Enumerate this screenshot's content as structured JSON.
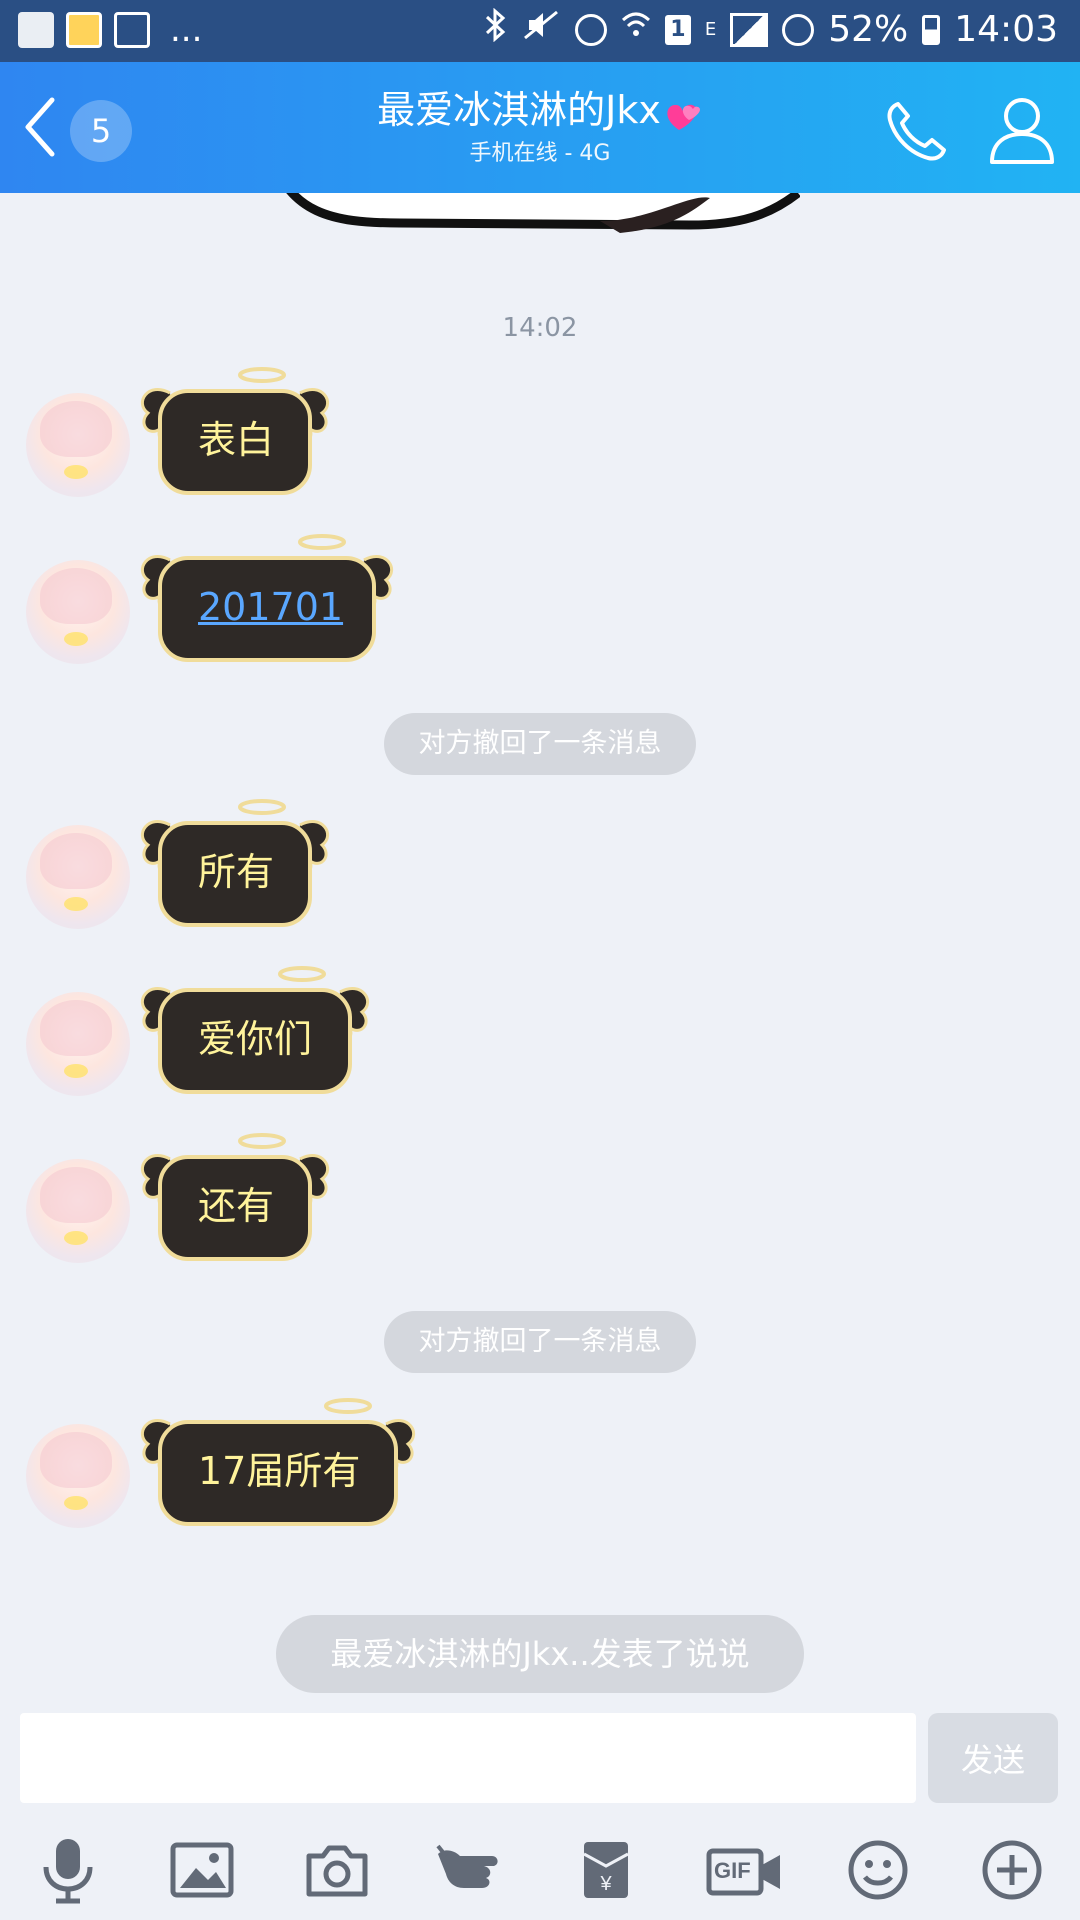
{
  "status_bar": {
    "battery_percent": "52%",
    "time": "14:03",
    "sim_slot": "1",
    "network_indicator": "E",
    "more_notifications": "..."
  },
  "header": {
    "unread_count": "5",
    "title": "最爱冰淇淋的Jkx",
    "subtitle": "手机在线 - 4G",
    "icons": [
      "back-chevron-icon",
      "phone-icon",
      "contact-icon",
      "heart-emoji-icon"
    ]
  },
  "chat": {
    "timestamp": "14:02",
    "messages": [
      {
        "type": "incoming",
        "text": "表白"
      },
      {
        "type": "incoming",
        "text": "201701",
        "is_link": true
      },
      {
        "type": "system",
        "text": "对方撤回了一条消息"
      },
      {
        "type": "incoming",
        "text": "所有"
      },
      {
        "type": "incoming",
        "text": "爱你们"
      },
      {
        "type": "incoming",
        "text": "还有"
      },
      {
        "type": "system",
        "text": "对方撤回了一条消息"
      },
      {
        "type": "incoming",
        "text": "17届所有"
      }
    ],
    "notification": "最爱冰淇淋的Jkx..发表了说说"
  },
  "input": {
    "value": "",
    "placeholder": "",
    "send_label": "发送"
  },
  "toolbar": {
    "gif_label": "GIF",
    "icons": [
      "microphone-icon",
      "image-icon",
      "camera-icon",
      "poke-icon",
      "red-packet-icon",
      "gif-video-icon",
      "emoji-icon",
      "plus-icon"
    ]
  },
  "colors": {
    "header_start": "#2f86f1",
    "header_end": "#21b3f3",
    "status_bar": "#2a4f84",
    "chat_background": "#eef1f7",
    "bubble_fill": "#2e2926",
    "bubble_text": "#fff39b",
    "link_text": "#5aa7ff",
    "system_pill": "#d4d7dd"
  }
}
